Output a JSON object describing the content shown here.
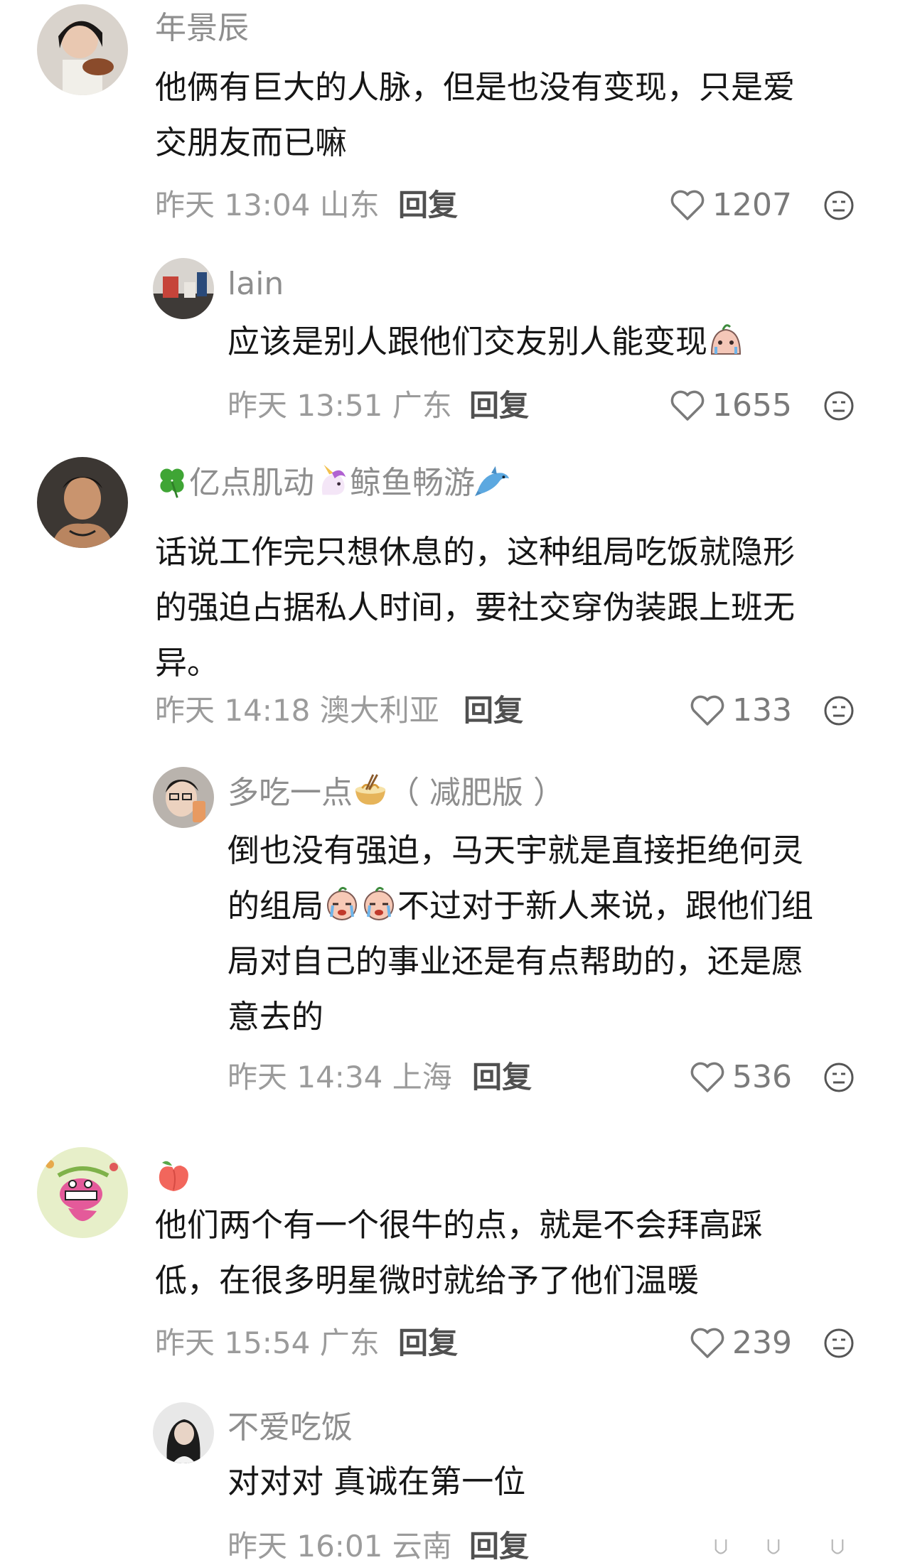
{
  "comments": [
    {
      "username": "年景辰",
      "text_line1": "他俩有巨大的人脉，但是也没有变现，只是爱",
      "text_line2": "交朋友而已嘛",
      "time": "昨天 13:04",
      "location": "山东",
      "reply_label": "回复",
      "likes": "1207",
      "avatar_icon": "person-eating-avatar"
    },
    {
      "username": "lain",
      "text_line1": "应该是别人跟他们交友别人能变现",
      "time": "昨天 13:51",
      "location": "广东",
      "reply_label": "回复",
      "likes": "1655",
      "avatar_icon": "desk-photo-avatar"
    },
    {
      "username_part1": "亿点肌动",
      "username_part2": "鲸鱼畅游",
      "text_line1": "话说工作完只想休息的，这种组局吃饭就隐形",
      "text_line2": "的强迫占据私人时间，要社交穿伪装跟上班无",
      "text_line3": "异。",
      "time": "昨天 14:18",
      "location": "澳大利亚",
      "reply_label": "回复",
      "likes": "133",
      "avatar_icon": "man-portrait-avatar"
    },
    {
      "username_part1": "多吃一点",
      "username_part2": "（ 减肥版 ）",
      "text_line1": "倒也没有强迫，马天宇就是直接拒绝何灵",
      "text_line2a": "的组局",
      "text_line2b": "不过对于新人来说，跟他们组",
      "text_line3": "局对自己的事业还是有点帮助的，还是愿",
      "text_line4": "意去的",
      "time": "昨天 14:34",
      "location": "上海",
      "reply_label": "回复",
      "likes": "536",
      "avatar_icon": "selfie-avatar"
    },
    {
      "text_line1": "他们两个有一个很牛的点，就是不会拜高踩",
      "text_line2": "低，在很多明星微时就给予了他们温暖",
      "time": "昨天 15:54",
      "location": "广东",
      "reply_label": "回复",
      "likes": "239",
      "avatar_icon": "cartoon-dino-avatar"
    },
    {
      "username": "不爱吃饭",
      "text_line1": "对对对 真诚在第一位",
      "time": "昨天 16:01",
      "location": "云南",
      "reply_label": "回复",
      "avatar_icon": "girl-portrait-avatar"
    }
  ],
  "colors": {
    "text": "#161616",
    "meta": "#9b9b9b",
    "username": "#8e8e8e"
  }
}
